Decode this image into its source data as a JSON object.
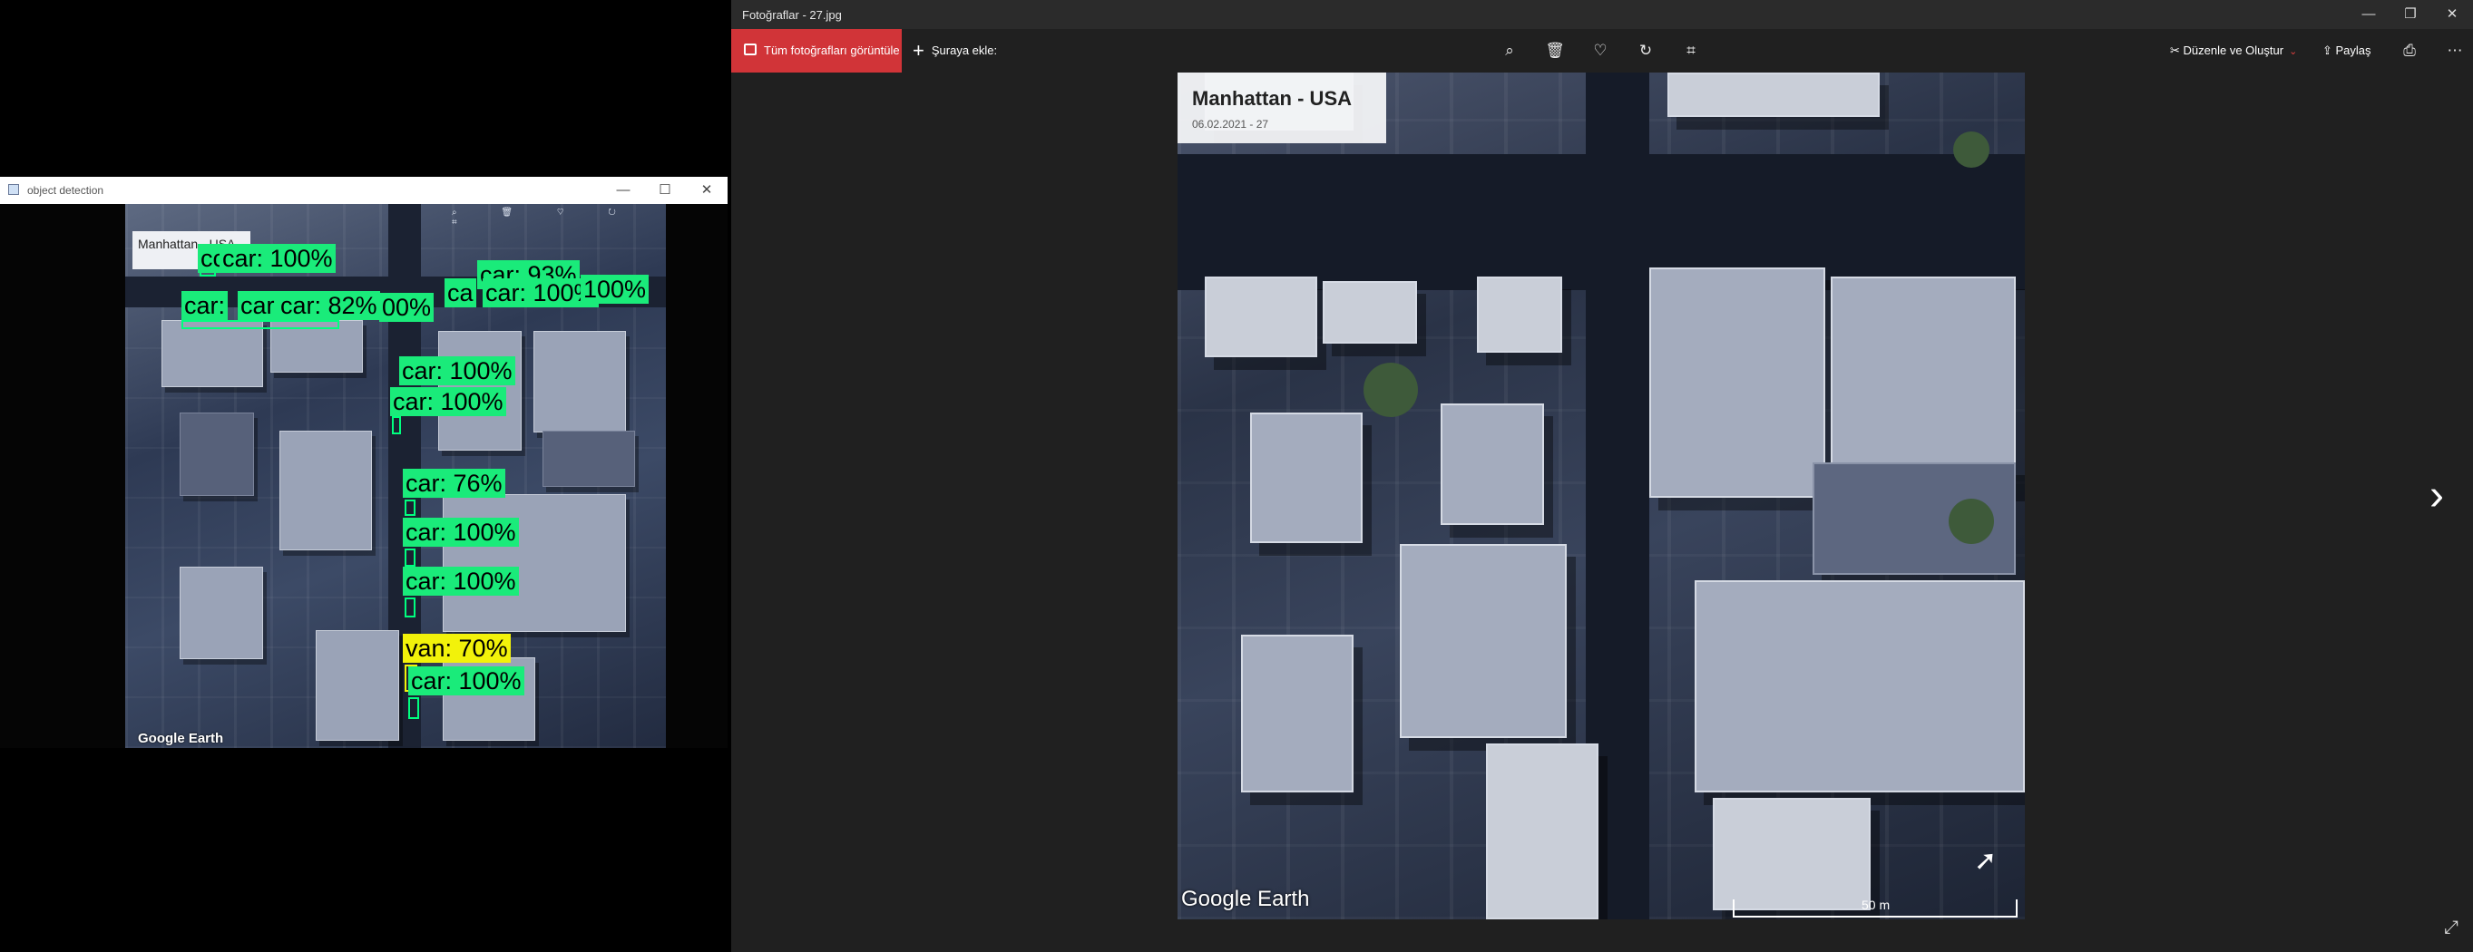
{
  "od_window": {
    "title": "object detection",
    "controls": {
      "minimize": "—",
      "maximize": "☐",
      "close": "✕"
    },
    "photo_label": "Manhattan - USA",
    "photo_logo": "Google Earth",
    "mini_toolbar": "⌕ 🗑 ♡ ↻ ⌗",
    "detections": [
      {
        "label": "car: 100%",
        "class": "car",
        "score": 1.0
      },
      {
        "label": "car: 93%",
        "class": "car",
        "score": 0.93
      },
      {
        "label": "car: 100%",
        "class": "car",
        "score": 1.0
      },
      {
        "label": "car: 82%",
        "class": "car",
        "score": 0.82
      },
      {
        "label": "car: 100%",
        "class": "car",
        "score": 1.0
      },
      {
        "label": "car: 100%",
        "class": "car",
        "score": 1.0
      },
      {
        "label": "car: 76%",
        "class": "car",
        "score": 0.76
      },
      {
        "label": "car: 100%",
        "class": "car",
        "score": 1.0
      },
      {
        "label": "car: 100%",
        "class": "car",
        "score": 1.0
      },
      {
        "label": "van: 70%",
        "class": "van",
        "score": 0.7
      },
      {
        "label": "car: 100%",
        "class": "car",
        "score": 1.0
      }
    ],
    "overlap_fragments": [
      "cc",
      "car:",
      "car",
      "00%",
      "ca",
      "100%"
    ],
    "colors": {
      "car": "#1aeb7a",
      "van": "#f2f20a"
    }
  },
  "photos_window": {
    "title": "Fotoğraflar - 27.jpg",
    "controls": {
      "minimize": "—",
      "restore": "❐",
      "close": "✕"
    },
    "toolbar": {
      "view_all": "Tüm fotoğrafları görüntüle",
      "add_to": "Şuraya ekle:",
      "edit_create": "Düzenle ve Oluştur",
      "share": "Paylaş",
      "icons": {
        "zoom": "⌕",
        "delete": "🗑",
        "favorite": "♡",
        "rotate": "↻",
        "crop": "⌗",
        "print": "⎙",
        "more": "⋯"
      }
    },
    "photo": {
      "title": "Manhattan - USA",
      "subtitle": "06.02.2021 - 27",
      "logo": "Google Earth",
      "scale": "50 m"
    },
    "next_arrow": "›",
    "fullscreen": "⤢",
    "accent_color": "#d13438"
  }
}
